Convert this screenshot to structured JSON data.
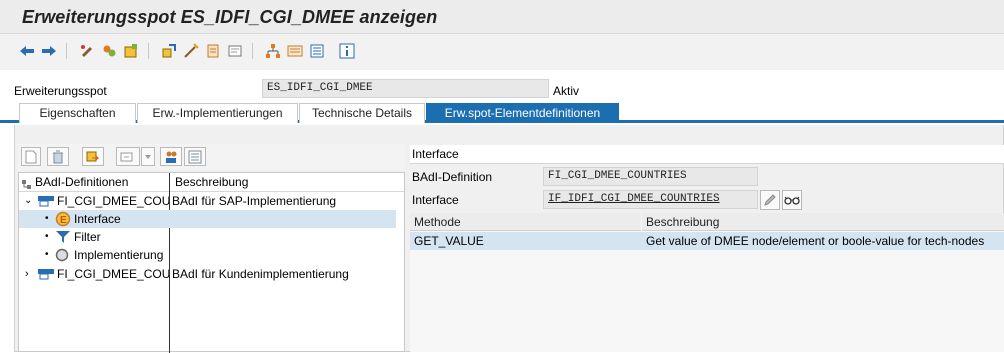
{
  "window": {
    "title": "Erweiterungsspot ES_IDFI_CGI_DMEE anzeigen"
  },
  "toolbar": {
    "icons": [
      "back-arrow-icon",
      "forward-arrow-icon",
      "display-change-icon",
      "other-object-icon",
      "activate-icon",
      "where-used-icon",
      "display-object-list-icon",
      "hierarchy-icon",
      "cgi-icon",
      "dmee-icon",
      "document-icon",
      "info-icon"
    ]
  },
  "header": {
    "label": "Erweiterungsspot",
    "value": "ES_IDFI_CGI_DMEE",
    "status": "Aktiv"
  },
  "tabs": [
    {
      "label": "Eigenschaften",
      "active": false
    },
    {
      "label": "Erw.-Implementierungen",
      "active": false
    },
    {
      "label": "Technische Details",
      "active": false
    },
    {
      "label": "Erw.spot-Elementdefinitionen",
      "active": true
    }
  ],
  "tree": {
    "columns": [
      "BAdI-Definitionen",
      "Beschreibung"
    ],
    "rows": [
      {
        "name": "FI_CGI_DMEE_COUN",
        "desc": "BAdI für SAP-Implementierung",
        "level": 0,
        "expanded": true
      },
      {
        "name": "Interface",
        "desc": "",
        "level": 1,
        "selected": true
      },
      {
        "name": "Filter",
        "desc": "",
        "level": 1
      },
      {
        "name": "Implementierung",
        "desc": "",
        "level": 1
      },
      {
        "name": "FI_CGI_DMEE_COUN",
        "desc": "BAdI für Kundenimplementierung",
        "level": 0,
        "expanded": false
      }
    ]
  },
  "details": {
    "title": "Interface",
    "badi_label": "BAdI-Definition",
    "badi_value": "FI_CGI_DMEE_COUNTRIES",
    "interface_label": "Interface",
    "interface_value": "IF_IDFI_CGI_DMEE_COUNTRIES",
    "table": {
      "columns": [
        "Methode",
        "Beschreibung"
      ],
      "rows": [
        {
          "method": "GET_VALUE",
          "desc": "Get value of DMEE node/element or boole-value for tech-nodes"
        }
      ]
    }
  },
  "colors": {
    "accent": "#1b6fb1",
    "selection": "#d4e4f1"
  }
}
